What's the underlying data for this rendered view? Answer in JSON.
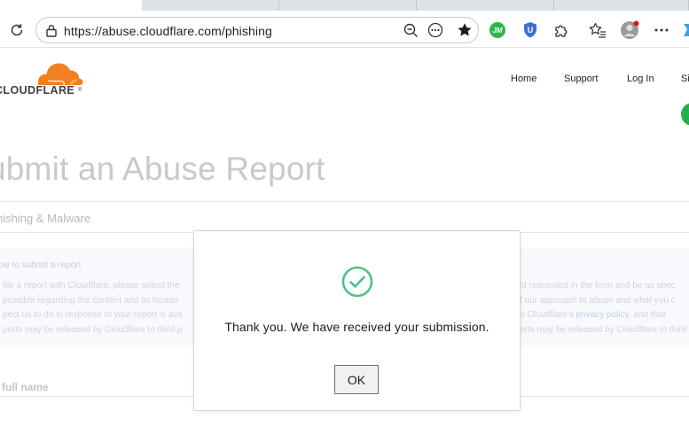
{
  "browser": {
    "url": "https://abuse.cloudflare.com/phishing",
    "extensions": [
      {
        "name": "jm-extension",
        "label": "JM",
        "color": "#2db74a"
      },
      {
        "name": "u-shield-extension",
        "label": "U",
        "color": "#3b6fd6"
      }
    ],
    "profile_notification_color": "#e81123"
  },
  "site": {
    "logo_text": "CLOUDFLARE",
    "logo_mark": "®",
    "brand_color": "#f38020",
    "nav": [
      "Home",
      "Support",
      "Log In",
      "Si"
    ]
  },
  "page": {
    "title": "ubmit an Abuse Report",
    "category": "hishing & Malware",
    "howto": {
      "heading": "ow to submit a report",
      "left_lines": [
        "file a report with Cloudflare, please select the",
        "possible regarding the content and its locatio",
        "pect us to do in response to your report is ava",
        "ports may be released by Cloudflare to third p"
      ],
      "right_lines": [
        "ld requested in the form and be as spec",
        "f our approach to abuse and what you c",
        "o Cloudflare's ",
        "orts may be released by Cloudflare to third"
      ],
      "link_text": "privacy policy",
      "line3_suffix": ", and that"
    },
    "field_label": "r full name"
  },
  "modal": {
    "message": "Thank you. We have received your submission.",
    "ok_label": "OK",
    "check_color": "#4cc183"
  }
}
